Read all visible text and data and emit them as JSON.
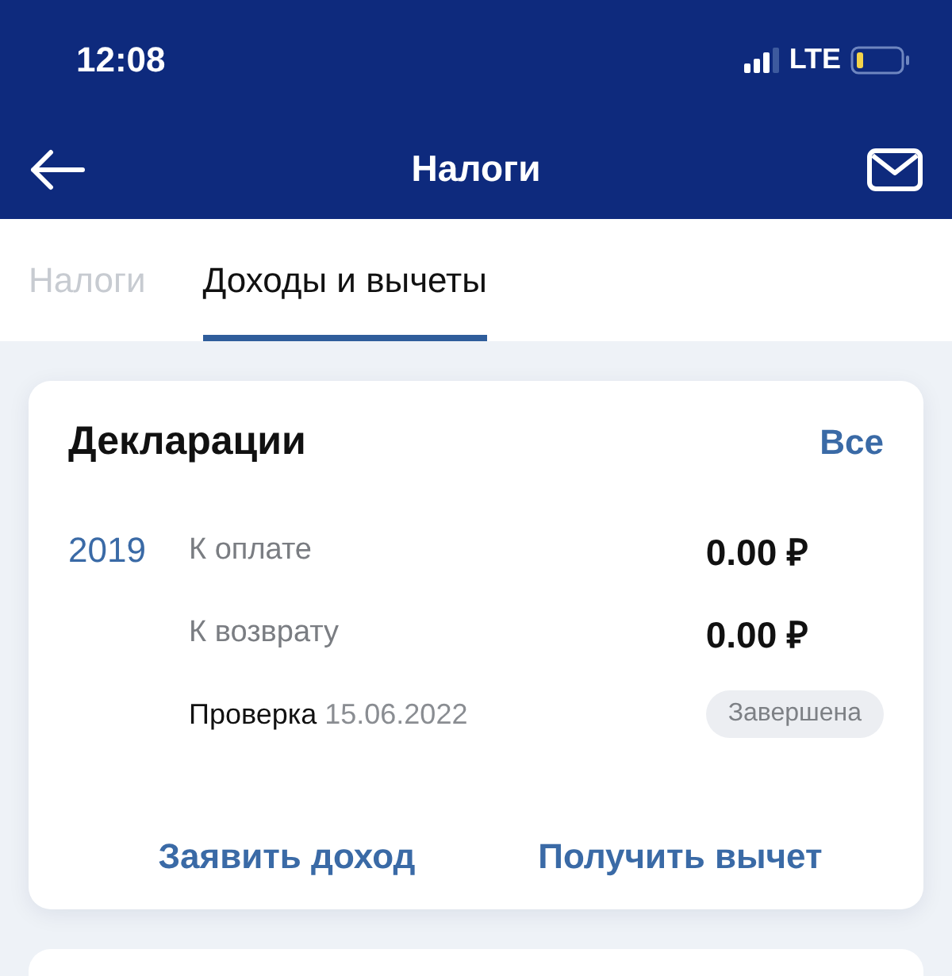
{
  "status_bar": {
    "time": "12:08",
    "network": "LTE"
  },
  "header": {
    "title": "Налоги"
  },
  "tabs": [
    {
      "label": "Налоги",
      "selected": false
    },
    {
      "label": "Доходы и вычеты",
      "selected": true
    }
  ],
  "declarations": {
    "title": "Декларации",
    "all_link": "Все",
    "year": "2019",
    "rows": [
      {
        "label": "К оплате",
        "amount": "0.00 ₽"
      },
      {
        "label": "К возврату",
        "amount": "0.00 ₽"
      }
    ],
    "check": {
      "label": "Проверка",
      "date": "15.06.2022",
      "status": "Завершена"
    },
    "actions": [
      "Заявить доход",
      "Получить вычет"
    ]
  }
}
